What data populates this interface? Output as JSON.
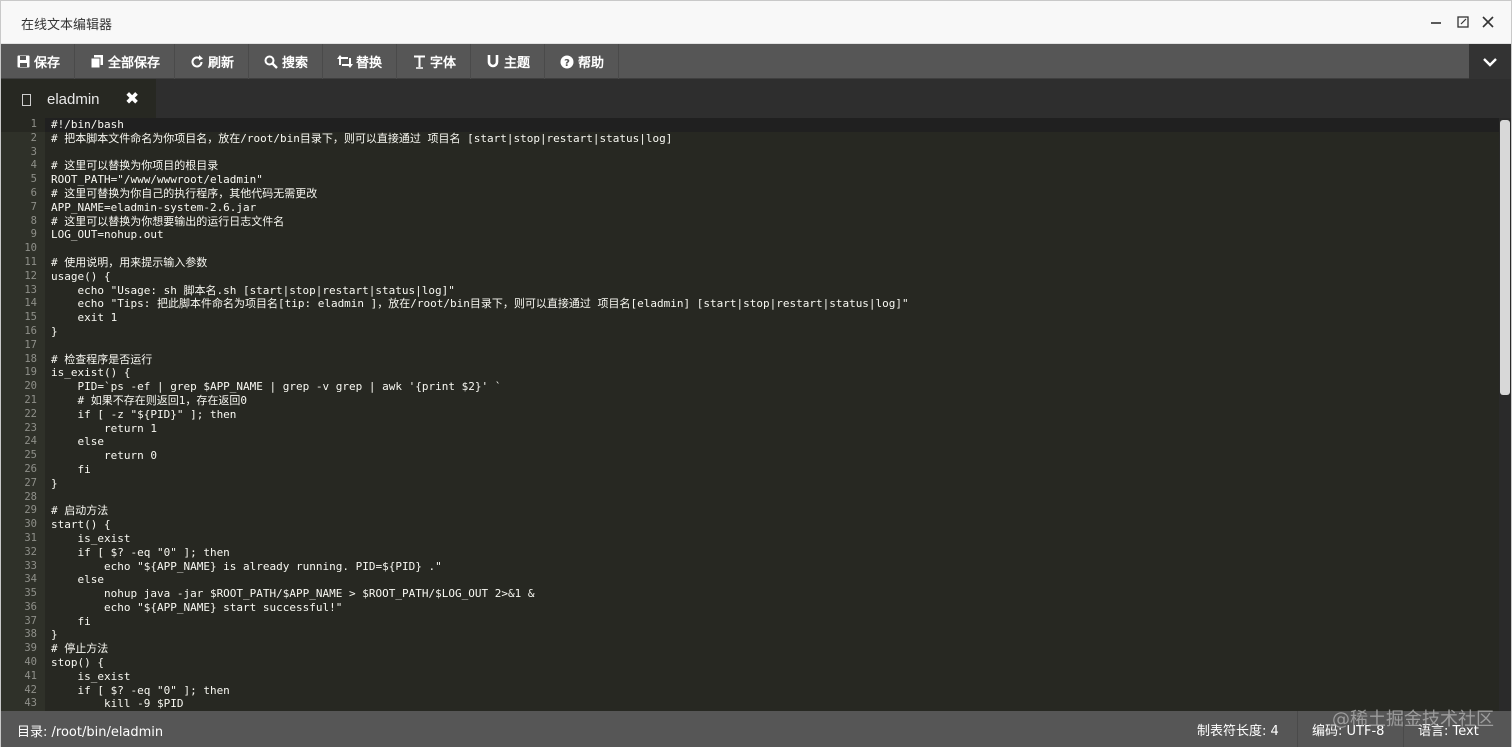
{
  "window": {
    "title": "在线文本编辑器"
  },
  "toolbar": {
    "buttons": [
      {
        "label": "保存",
        "icon": "floppy-disk-icon"
      },
      {
        "label": "全部保存",
        "icon": "copy-icon"
      },
      {
        "label": "刷新",
        "icon": "refresh-icon"
      },
      {
        "label": "搜索",
        "icon": "search-icon"
      },
      {
        "label": "替换",
        "icon": "retweet-icon"
      },
      {
        "label": "字体",
        "icon": "text-cursor-icon"
      },
      {
        "label": "主题",
        "icon": "magnet-icon"
      },
      {
        "label": "帮助",
        "icon": "help-circle-icon"
      }
    ]
  },
  "tab": {
    "label": "eladmin",
    "close_glyph": "✖"
  },
  "editor": {
    "line_numbers": [
      "1",
      "2",
      "3",
      "4",
      "5",
      "6",
      "7",
      "8",
      "9",
      "10",
      "11",
      "12",
      "13",
      "14",
      "15",
      "16",
      "17",
      "18",
      "19",
      "20",
      "21",
      "22",
      "23",
      "24",
      "25",
      "26",
      "27",
      "28",
      "29",
      "30",
      "31",
      "32",
      "33",
      "34",
      "35",
      "36",
      "37",
      "38",
      "39",
      "40",
      "41",
      "42",
      "43"
    ],
    "lines": [
      "#!/bin/bash",
      "# 把本脚本文件命名为你项目名，放在/root/bin目录下，则可以直接通过 项目名 [start|stop|restart|status|log]",
      "",
      "# 这里可以替换为你项目的根目录",
      "ROOT_PATH=\"/www/wwwroot/eladmin\"",
      "# 这里可替换为你自己的执行程序，其他代码无需更改",
      "APP_NAME=eladmin-system-2.6.jar",
      "# 这里可以替换为你想要输出的运行日志文件名",
      "LOG_OUT=nohup.out",
      "",
      "# 使用说明，用来提示输入参数",
      "usage() {",
      "    echo \"Usage: sh 脚本名.sh [start|stop|restart|status|log]\"",
      "    echo \"Tips: 把此脚本件命名为项目名[tip: eladmin ]，放在/root/bin目录下，则可以直接通过 项目名[eladmin] [start|stop|restart|status|log]\"",
      "    exit 1",
      "}",
      "",
      "# 检查程序是否运行",
      "is_exist() {",
      "    PID=`ps -ef | grep $APP_NAME | grep -v grep | awk '{print $2}' `",
      "    # 如果不存在则返回1，存在返回0",
      "    if [ -z \"${PID}\" ]; then",
      "        return 1",
      "    else",
      "        return 0",
      "    fi",
      "}",
      "",
      "# 启动方法",
      "start() {",
      "    is_exist",
      "    if [ $? -eq \"0\" ]; then",
      "        echo \"${APP_NAME} is already running. PID=${PID} .\"",
      "    else",
      "        nohup java -jar $ROOT_PATH/$APP_NAME > $ROOT_PATH/$LOG_OUT 2>&1 &",
      "        echo \"${APP_NAME} start successful!\"",
      "    fi",
      "}",
      "# 停止方法",
      "stop() {",
      "    is_exist",
      "    if [ $? -eq \"0\" ]; then",
      "        kill -9 $PID"
    ]
  },
  "statusbar": {
    "path": "目录: /root/bin/eladmin",
    "tab_size": "制表符长度: 4",
    "encoding": "编码: UTF-8",
    "language": "语言: Text"
  },
  "watermark": "@稀土掘金技术社区",
  "colors": {
    "editor_bg": "#272822",
    "toolbar_bg": "#565656",
    "text": "#f8f8f2",
    "gutter_text": "#8f908a"
  }
}
